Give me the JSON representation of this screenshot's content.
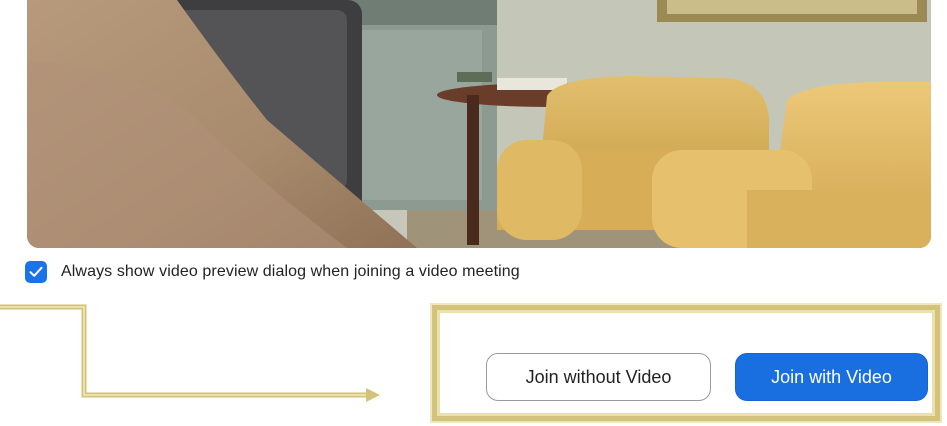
{
  "preview": {
    "option_label": "Always show video preview dialog when joining a video meeting",
    "option_checked": true
  },
  "actions": {
    "join_without_video_label": "Join without Video",
    "join_with_video_label": "Join with Video"
  },
  "colors": {
    "accent": "#1a6fe0",
    "annotation": "#d3c27a"
  },
  "icons": {
    "checkbox": "check-mark"
  }
}
